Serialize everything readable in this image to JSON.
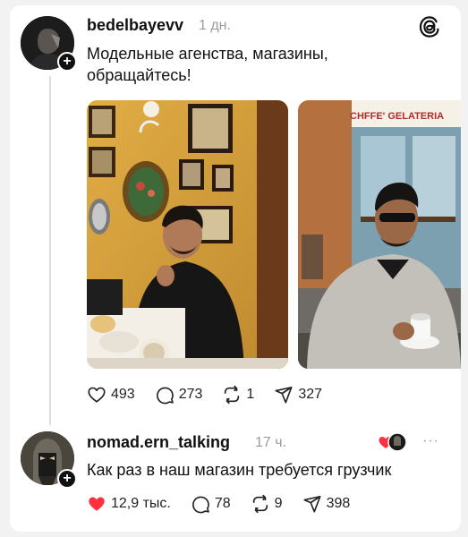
{
  "post": {
    "username": "bedelbayevv",
    "time": "1 дн.",
    "text": "Модельные агенства, магазины, обращайтесь!",
    "photo2_sign": "CHFFE' GELATERIA",
    "actions": {
      "likes": "493",
      "comments": "273",
      "reposts": "1",
      "shares": "327"
    }
  },
  "reply": {
    "username": "nomad.ern_talking",
    "time": "17 ч.",
    "text": "Как раз в наш магазин требуется грузчик",
    "more": "···",
    "actions": {
      "likes": "12,9 тыс.",
      "comments": "78",
      "reposts": "9",
      "shares": "398"
    }
  },
  "colors": {
    "like_red": "#ff3040",
    "text": "#111111",
    "muted": "#9b9b9b"
  }
}
